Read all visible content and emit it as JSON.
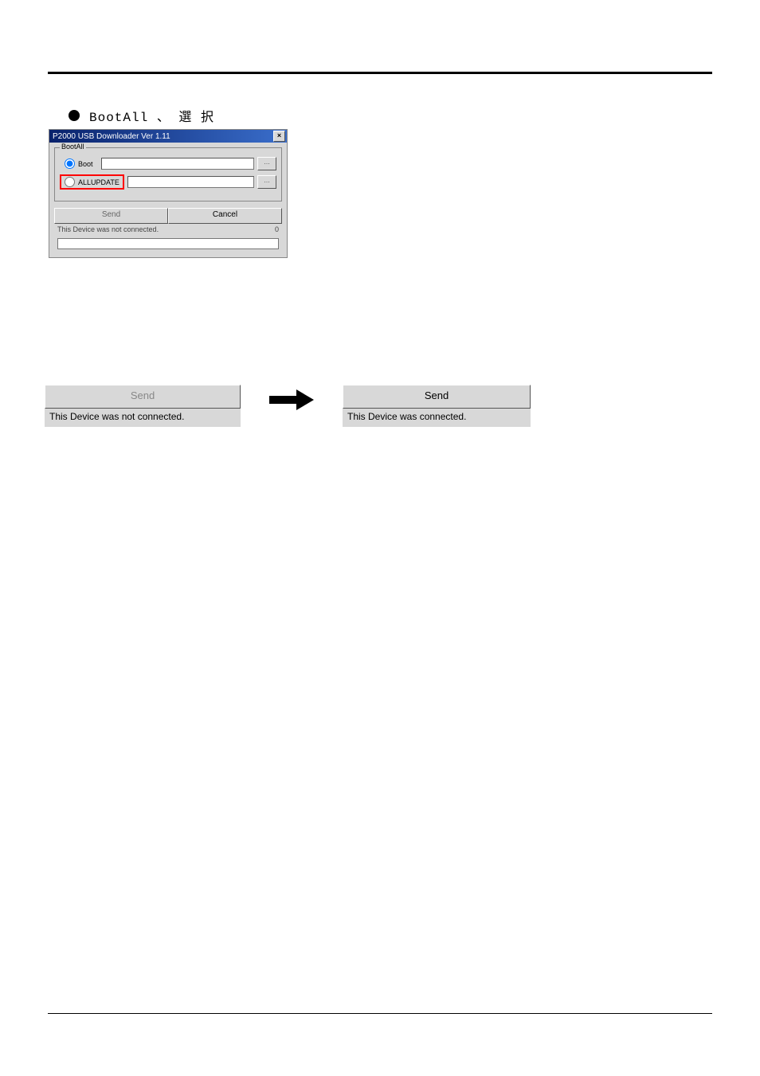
{
  "header": {
    "bullet": "BootAll 、 選 択"
  },
  "dialog": {
    "title": "P2000 USB Downloader Ver 1.11",
    "group_label": "BootAll",
    "radio_boot": "Boot",
    "radio_allupdate": "ALLUPDATE",
    "browse_label": "...",
    "send_label": "Send",
    "cancel_label": "Cancel",
    "status": "This Device was not connected.",
    "count": "0"
  },
  "before": {
    "send_label": "Send",
    "status": "This Device was not connected."
  },
  "after": {
    "send_label": "Send",
    "status": "This Device was connected."
  },
  "colors": {
    "highlight": "#ff0000",
    "titlebar_start": "#08216b",
    "titlebar_end": "#3a6ecb"
  }
}
